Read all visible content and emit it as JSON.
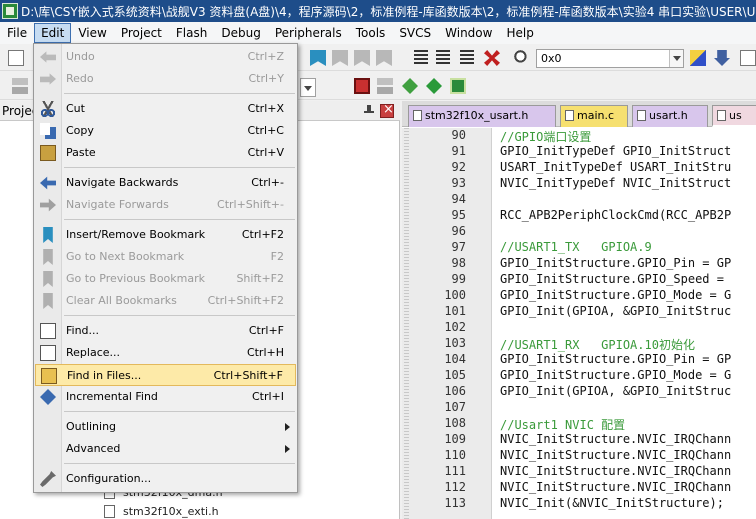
{
  "window": {
    "title": "D:\\库\\CSY嵌入式系统资料\\战舰V3 资料盘(A盘)\\4，程序源码\\2，标准例程-库函数版本\\2，标准例程-库函数版本\\实验4 串口实验\\USER\\USART"
  },
  "menubar": {
    "items": [
      "File",
      "Edit",
      "View",
      "Project",
      "Flash",
      "Debug",
      "Peripherals",
      "Tools",
      "SVCS",
      "Window",
      "Help"
    ]
  },
  "toolbar": {
    "address_value": "0x0"
  },
  "edit_menu": {
    "items": [
      {
        "label": "Undo",
        "shortcut": "Ctrl+Z",
        "disabled": true,
        "icon": "undo-icon"
      },
      {
        "label": "Redo",
        "shortcut": "Ctrl+Y",
        "disabled": true,
        "icon": "redo-icon"
      },
      {
        "label": "Cut",
        "shortcut": "Ctrl+X",
        "disabled": false,
        "icon": "cut-icon"
      },
      {
        "label": "Copy",
        "shortcut": "Ctrl+C",
        "disabled": false,
        "icon": "copy-icon"
      },
      {
        "label": "Paste",
        "shortcut": "Ctrl+V",
        "disabled": false,
        "icon": "paste-icon"
      },
      {
        "label": "Navigate Backwards",
        "shortcut": "Ctrl+-",
        "disabled": false,
        "icon": "back-arrow-icon"
      },
      {
        "label": "Navigate Forwards",
        "shortcut": "Ctrl+Shift+-",
        "disabled": true,
        "icon": "forward-arrow-icon"
      },
      {
        "label": "Insert/Remove Bookmark",
        "shortcut": "Ctrl+F2",
        "disabled": false,
        "icon": "bookmark-icon"
      },
      {
        "label": "Go to Next Bookmark",
        "shortcut": "F2",
        "disabled": true,
        "icon": "next-bookmark-icon"
      },
      {
        "label": "Go to Previous Bookmark",
        "shortcut": "Shift+F2",
        "disabled": true,
        "icon": "previous-bookmark-icon"
      },
      {
        "label": "Clear All Bookmarks",
        "shortcut": "Ctrl+Shift+F2",
        "disabled": true,
        "icon": "clear-bookmarks-icon"
      },
      {
        "label": "Find...",
        "shortcut": "Ctrl+F",
        "disabled": false,
        "icon": "find-icon"
      },
      {
        "label": "Replace...",
        "shortcut": "Ctrl+H",
        "disabled": false,
        "icon": "replace-icon"
      },
      {
        "label": "Find in Files...",
        "shortcut": "Ctrl+Shift+F",
        "disabled": false,
        "highlighted": true,
        "icon": "find-in-files-icon"
      },
      {
        "label": "Incremental Find",
        "shortcut": "Ctrl+I",
        "disabled": false,
        "icon": "incremental-find-icon"
      },
      {
        "label": "Outlining",
        "shortcut": "",
        "disabled": false,
        "submenu": true
      },
      {
        "label": "Advanced",
        "shortcut": "",
        "disabled": false,
        "submenu": true
      },
      {
        "label": "Configuration...",
        "shortcut": "",
        "disabled": false,
        "icon": "wrench-icon"
      }
    ]
  },
  "project_panel": {
    "title": "Projec",
    "tree_items": [
      "stm32f10x_dma.h",
      "stm32f10x_exti.h"
    ]
  },
  "editor": {
    "tabs": [
      "stm32f10x_usart.h",
      "main.c",
      "usart.h",
      "us"
    ],
    "lines": [
      {
        "n": "90",
        "text": "//GPIO端口设置",
        "comment": true
      },
      {
        "n": "91",
        "text": "GPIO_InitTypeDef GPIO_InitStruct",
        "comment": false
      },
      {
        "n": "92",
        "text": "USART_InitTypeDef USART_InitStru",
        "comment": false
      },
      {
        "n": "93",
        "text": "NVIC_InitTypeDef NVIC_InitStruct",
        "comment": false
      },
      {
        "n": "94",
        "text": "",
        "comment": false
      },
      {
        "n": "95",
        "text": "RCC_APB2PeriphClockCmd(RCC_APB2P",
        "comment": false
      },
      {
        "n": "96",
        "text": "",
        "comment": false
      },
      {
        "n": "97",
        "text": "//USART1_TX   GPIOA.9",
        "comment": true
      },
      {
        "n": "98",
        "text": "GPIO_InitStructure.GPIO_Pin = GP",
        "comment": false
      },
      {
        "n": "99",
        "text": "GPIO_InitStructure.GPIO_Speed = ",
        "comment": false
      },
      {
        "n": "100",
        "text": "GPIO_InitStructure.GPIO_Mode = G",
        "comment": false
      },
      {
        "n": "101",
        "text": "GPIO_Init(GPIOA, &GPIO_InitStruc",
        "comment": false
      },
      {
        "n": "102",
        "text": "",
        "comment": false
      },
      {
        "n": "103",
        "text": "//USART1_RX   GPIOA.10初始化",
        "comment": true
      },
      {
        "n": "104",
        "text": "GPIO_InitStructure.GPIO_Pin = GP",
        "comment": false
      },
      {
        "n": "105",
        "text": "GPIO_InitStructure.GPIO_Mode = G",
        "comment": false
      },
      {
        "n": "106",
        "text": "GPIO_Init(GPIOA, &GPIO_InitStruc",
        "comment": false
      },
      {
        "n": "107",
        "text": "",
        "comment": false
      },
      {
        "n": "108",
        "text": "//Usart1 NVIC 配置",
        "comment": true
      },
      {
        "n": "109",
        "text": "NVIC_InitStructure.NVIC_IRQChann",
        "comment": false
      },
      {
        "n": "110",
        "text": "NVIC_InitStructure.NVIC_IRQChann",
        "comment": false
      },
      {
        "n": "111",
        "text": "NVIC_InitStructure.NVIC_IRQChann",
        "comment": false
      },
      {
        "n": "112",
        "text": "NVIC_InitStructure.NVIC_IRQChann",
        "comment": false
      },
      {
        "n": "113",
        "text": "NVIC_Init(&NVIC_InitStructure);",
        "comment": false
      }
    ]
  }
}
